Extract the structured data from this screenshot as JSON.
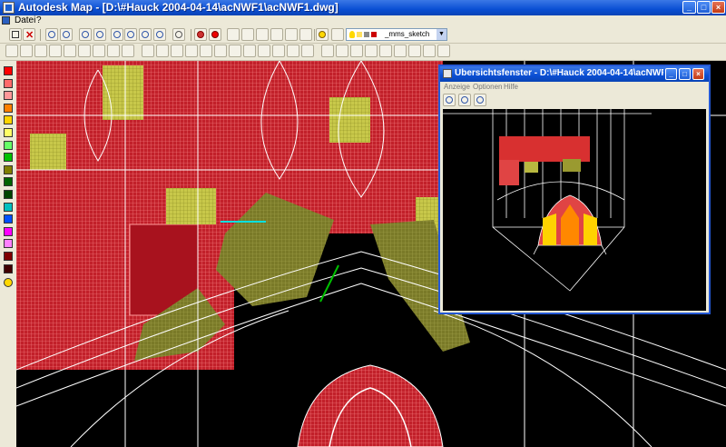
{
  "window": {
    "title": "Autodesk Map - [D:\\#Hauck 2004-04-14\\acNWF1\\acNWF1.dwg]",
    "controls": {
      "minimize": "_",
      "maximize": "□",
      "close": "×"
    }
  },
  "menubar": {
    "items": [
      "Datei",
      "?"
    ]
  },
  "toolbar": {
    "layer_name": "_mms_sketch",
    "icons": [
      "save-icon",
      "cancel-icon",
      "zoom-in-icon",
      "zoom-out-icon",
      "zoom-realtime-icon",
      "zoom-window-icon",
      "zoom-previous-icon",
      "pan-icon",
      "regen-icon",
      "select-icon",
      "smiley-icon"
    ]
  },
  "palette": {
    "colors": [
      "#ff0000",
      "#ff6a6a",
      "#ff9999",
      "#ff7f00",
      "#ffd400",
      "#ffff66",
      "#66ff66",
      "#00c000",
      "#7f7f00",
      "#006400",
      "#004400",
      "#00c0c0",
      "#0050ff",
      "#ff00ff",
      "#ff80ff",
      "#7f0000",
      "#400000"
    ]
  },
  "overview": {
    "title": "Übersichtsfenster - D:\\#Hauck 2004-04-14\\acNWF1\\acN",
    "menu": [
      "Anzeige",
      "Optionen",
      "Hilfe"
    ],
    "controls": {
      "minimize": "_",
      "maximize": "□",
      "close": "×"
    }
  },
  "drawing": {
    "colors": {
      "red": "#c2202a",
      "yellow": "#c8c84a",
      "olive": "#8a8a2a",
      "white": "#ffffff",
      "black": "#000000",
      "cyan": "#00e0e0",
      "green": "#00c000"
    }
  }
}
